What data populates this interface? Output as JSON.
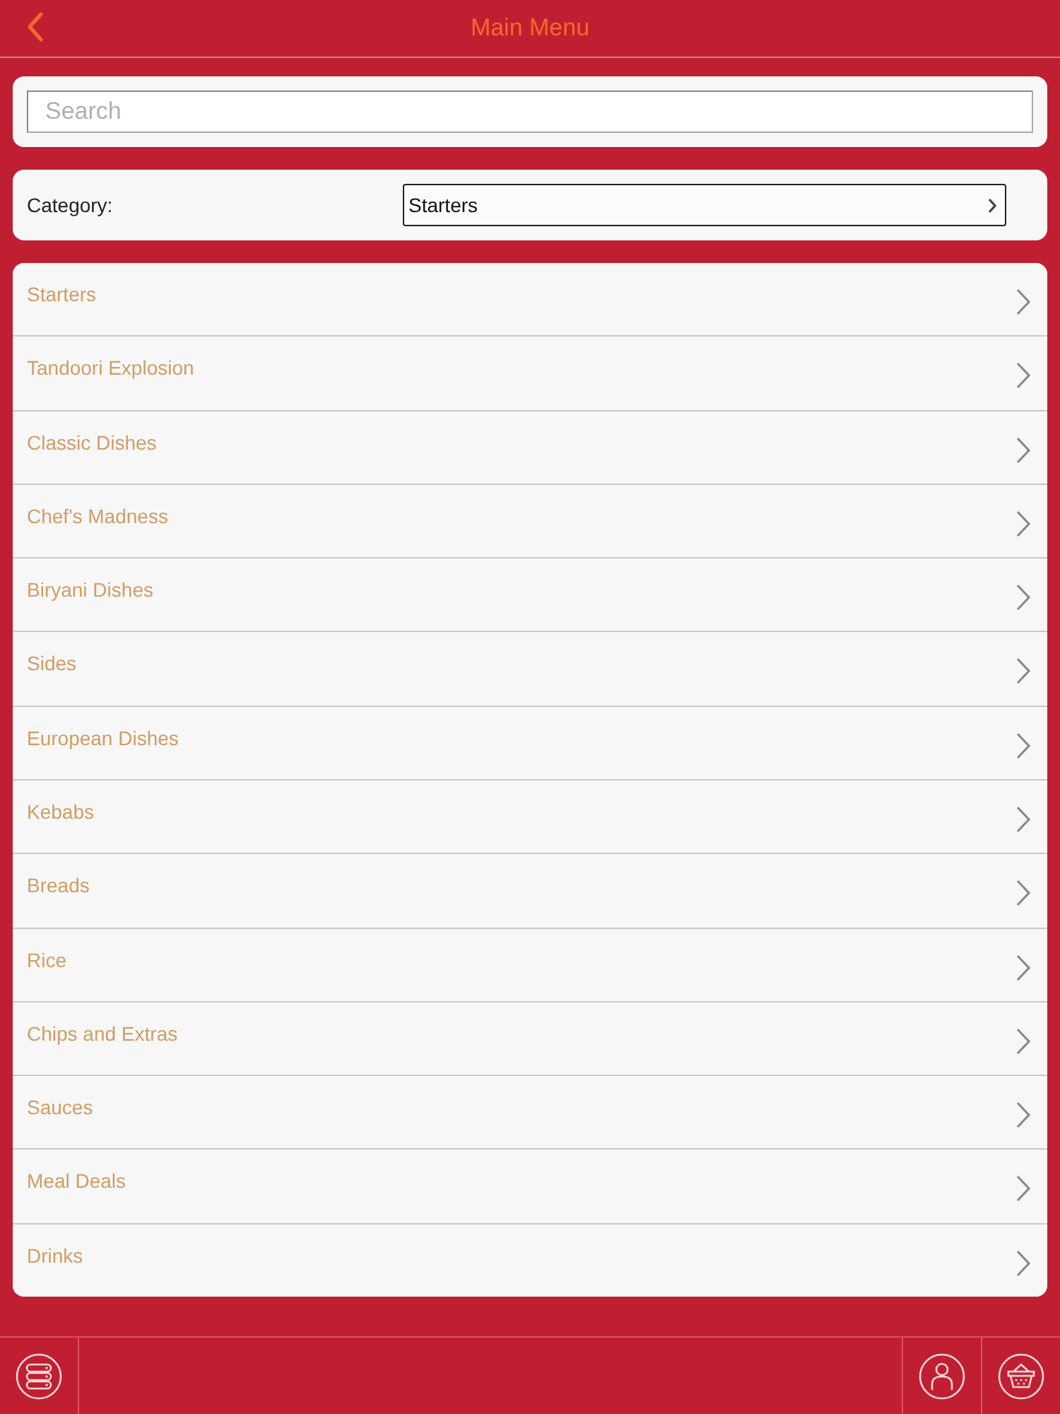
{
  "header": {
    "title": "Main Menu"
  },
  "search": {
    "placeholder": "Search"
  },
  "category": {
    "label": "Category:",
    "value": "Starters"
  },
  "menu": {
    "items": [
      "Starters",
      "Tandoori Explosion",
      "Classic Dishes",
      "Chef's Madness",
      "Biryani Dishes",
      "Sides",
      "European Dishes",
      "Kebabs",
      "Breads",
      "Rice",
      "Chips and Extras",
      "Sauces",
      "Meal Deals",
      "Drinks"
    ]
  }
}
